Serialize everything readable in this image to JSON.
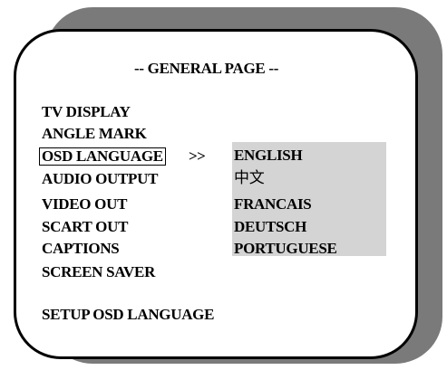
{
  "page_title": "-- GENERAL PAGE --",
  "menu": {
    "items": [
      {
        "label": "TV DISPLAY",
        "selected": false
      },
      {
        "label": "ANGLE MARK",
        "selected": false
      },
      {
        "label": "OSD LANGUAGE",
        "selected": true
      },
      {
        "label": "AUDIO OUTPUT",
        "selected": false
      },
      {
        "label": "VIDEO OUT",
        "selected": false
      },
      {
        "label": "SCART OUT",
        "selected": false
      },
      {
        "label": "CAPTIONS",
        "selected": false
      },
      {
        "label": "SCREEN SAVER",
        "selected": false
      }
    ],
    "selected_arrow": ">>"
  },
  "options": {
    "items": [
      "ENGLISH",
      "中文",
      "FRANCAIS",
      "DEUTSCH",
      "PORTUGUESE"
    ],
    "background_color": "#d4d4d4"
  },
  "help_text": "SETUP OSD LANGUAGE",
  "colors": {
    "text": "#000000",
    "panel": "#ffffff",
    "shadow": "#7a7a7a",
    "options_bg": "#d4d4d4"
  }
}
